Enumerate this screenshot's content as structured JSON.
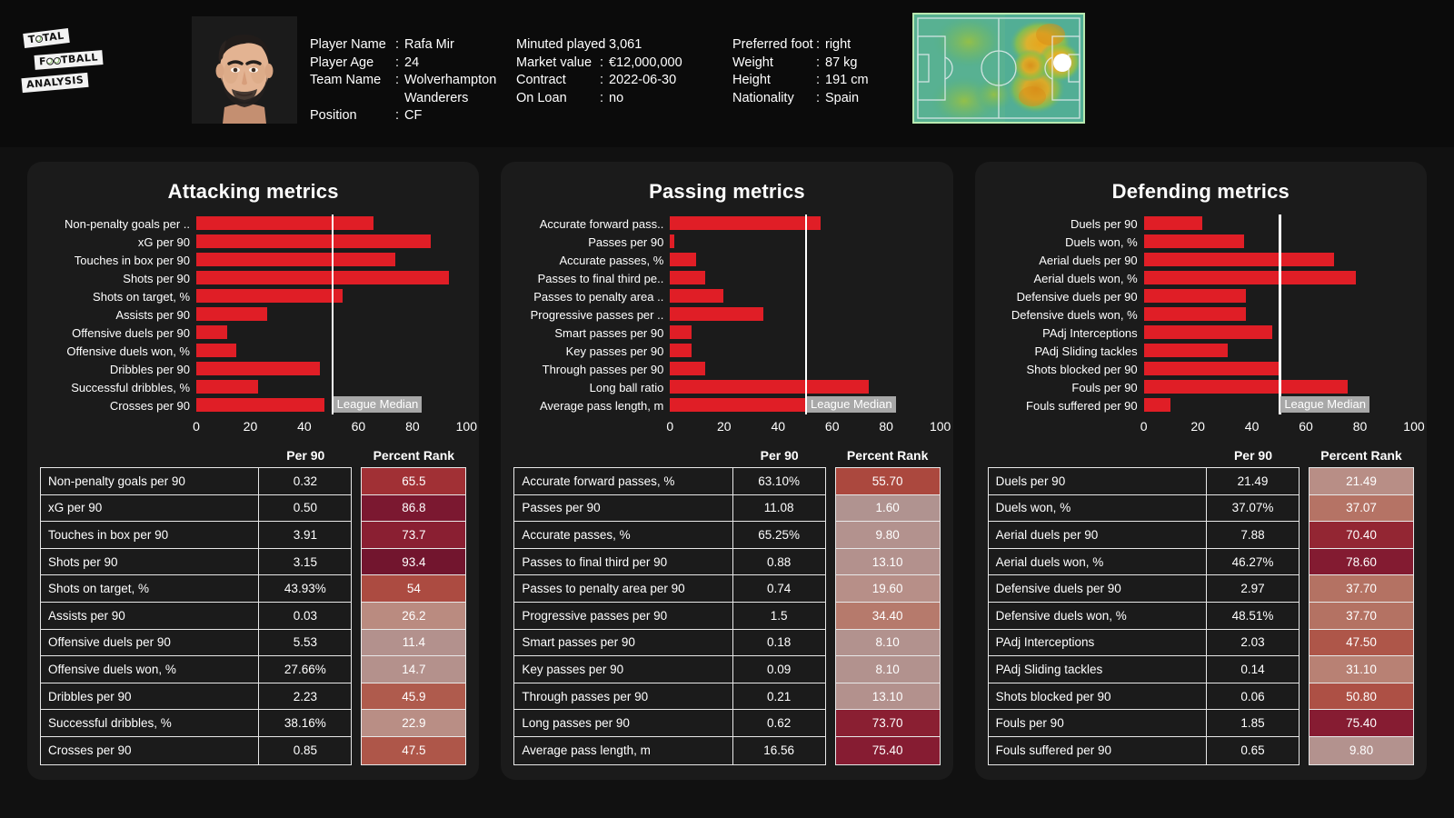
{
  "brand": {
    "line1": "TOTAL",
    "line2": "FOOTBALL",
    "line3": "ANALYSIS"
  },
  "header": {
    "photo_alt": "player-portrait",
    "heatmap_alt": "player-heatmap",
    "columns": [
      {
        "name": "identity",
        "rows": [
          {
            "label": "Player Name",
            "sep": ":",
            "value": "Rafa Mir"
          },
          {
            "label": "Player Age",
            "sep": ":",
            "value": "24"
          },
          {
            "label": "Team Name",
            "sep": ":",
            "value": "Wolverhampton"
          },
          {
            "label": "",
            "sep": "",
            "value": "Wanderers"
          },
          {
            "label": "Position",
            "sep": ":",
            "value": "CF"
          }
        ]
      },
      {
        "name": "contract",
        "rows": [
          {
            "label": "Minuted played",
            "sep": ":",
            "value": "3,061"
          },
          {
            "label": "Market value",
            "sep": ":",
            "value": "€12,000,000"
          },
          {
            "label": "Contract",
            "sep": ":",
            "value": "2022-06-30"
          },
          {
            "label": "On Loan",
            "sep": ":",
            "value": "no"
          }
        ]
      },
      {
        "name": "physical",
        "rows": [
          {
            "label": "Preferred foot",
            "sep": ":",
            "value": "right"
          },
          {
            "label": "Weight",
            "sep": ":",
            "value": "87 kg"
          },
          {
            "label": "Height",
            "sep": ":",
            "value": "191 cm"
          },
          {
            "label": "Nationality",
            "sep": ":",
            "value": "Spain"
          }
        ]
      }
    ]
  },
  "colors": {
    "bar": "#e01e26",
    "median_line": "#ffffff",
    "median_label_bg": "#a8a8a8",
    "panel_bg": "#1b1b1b",
    "page_bg": "#111111",
    "header_bg": "#0b0b0b"
  },
  "median_label": "League Median",
  "table_headers": {
    "metric": "",
    "per90": "Per 90",
    "rank": "Percent Rank"
  },
  "chart_data": [
    {
      "type": "bar",
      "name": "attacking",
      "title": "Attacking metrics",
      "xlabel": "",
      "ylabel": "",
      "xlim": [
        0,
        100
      ],
      "ticks": [
        0,
        20,
        40,
        60,
        80,
        100
      ],
      "median": 50,
      "median_label": "League Median",
      "orientation": "horizontal",
      "grid": false,
      "legend": "none",
      "categories": [
        "Non-penalty goals per ..",
        "xG per 90",
        "Touches in box per 90",
        "Shots per 90",
        "Shots on target, %",
        "Assists per 90",
        "Offensive duels per 90",
        "Offensive duels won, %",
        "Dribbles per 90",
        "Successful dribbles, %",
        "Crosses per 90"
      ],
      "values": [
        65.5,
        86.8,
        73.7,
        93.4,
        54,
        26.2,
        11.4,
        14.7,
        45.9,
        22.9,
        47.5
      ],
      "table": {
        "columns": [
          "",
          "Per 90",
          "Percent Rank"
        ],
        "rows": [
          {
            "metric": "Non-penalty goals per 90",
            "per90": "0.32",
            "rank": "65.5",
            "rank_value": 65.5
          },
          {
            "metric": "xG per 90",
            "per90": "0.50",
            "rank": "86.8",
            "rank_value": 86.8
          },
          {
            "metric": "Touches in box per 90",
            "per90": "3.91",
            "rank": "73.7",
            "rank_value": 73.7
          },
          {
            "metric": "Shots per 90",
            "per90": "3.15",
            "rank": "93.4",
            "rank_value": 93.4
          },
          {
            "metric": "Shots on target, %",
            "per90": "43.93%",
            "rank": "54",
            "rank_value": 54
          },
          {
            "metric": "Assists per 90",
            "per90": "0.03",
            "rank": "26.2",
            "rank_value": 26.2
          },
          {
            "metric": "Offensive duels per 90",
            "per90": "5.53",
            "rank": "11.4",
            "rank_value": 11.4
          },
          {
            "metric": "Offensive duels won, %",
            "per90": "27.66%",
            "rank": "14.7",
            "rank_value": 14.7
          },
          {
            "metric": "Dribbles per 90",
            "per90": "2.23",
            "rank": "45.9",
            "rank_value": 45.9
          },
          {
            "metric": "Successful dribbles, %",
            "per90": "38.16%",
            "rank": "22.9",
            "rank_value": 22.9
          },
          {
            "metric": "Crosses per 90",
            "per90": "0.85",
            "rank": "47.5",
            "rank_value": 47.5
          }
        ]
      }
    },
    {
      "type": "bar",
      "name": "passing",
      "title": "Passing metrics",
      "xlabel": "",
      "ylabel": "",
      "xlim": [
        0,
        100
      ],
      "ticks": [
        0,
        20,
        40,
        60,
        80,
        100
      ],
      "median": 50,
      "median_label": "League Median",
      "orientation": "horizontal",
      "grid": false,
      "legend": "none",
      "categories": [
        "Accurate forward pass..",
        "Passes per 90",
        "Accurate passes, %",
        "Passes to final third pe..",
        "Passes to penalty area ..",
        "Progressive passes per ..",
        "Smart passes per 90",
        "Key passes per 90",
        "Through passes per 90",
        "Long ball ratio",
        "Average pass length, m"
      ],
      "values": [
        55.7,
        1.6,
        9.8,
        13.1,
        19.6,
        34.4,
        8.1,
        8.1,
        13.1,
        73.7,
        75.4
      ],
      "table": {
        "columns": [
          "",
          "Per 90",
          "Percent Rank"
        ],
        "rows": [
          {
            "metric": "Accurate forward passes, %",
            "per90": "63.10%",
            "rank": "55.70",
            "rank_value": 55.7
          },
          {
            "metric": "Passes per 90",
            "per90": "11.08",
            "rank": "1.60",
            "rank_value": 1.6
          },
          {
            "metric": "Accurate passes, %",
            "per90": "65.25%",
            "rank": "9.80",
            "rank_value": 9.8
          },
          {
            "metric": "Passes to final third per 90",
            "per90": "0.88",
            "rank": "13.10",
            "rank_value": 13.1
          },
          {
            "metric": "Passes to penalty area per 90",
            "per90": "0.74",
            "rank": "19.60",
            "rank_value": 19.6
          },
          {
            "metric": "Progressive passes per 90",
            "per90": "1.5",
            "rank": "34.40",
            "rank_value": 34.4
          },
          {
            "metric": "Smart passes per 90",
            "per90": "0.18",
            "rank": "8.10",
            "rank_value": 8.1
          },
          {
            "metric": "Key passes per 90",
            "per90": "0.09",
            "rank": "8.10",
            "rank_value": 8.1
          },
          {
            "metric": "Through passes per 90",
            "per90": "0.21",
            "rank": "13.10",
            "rank_value": 13.1
          },
          {
            "metric": "Long passes per 90",
            "per90": "0.62",
            "rank": "73.70",
            "rank_value": 73.7
          },
          {
            "metric": "Average pass length, m",
            "per90": "16.56",
            "rank": "75.40",
            "rank_value": 75.4
          }
        ]
      }
    },
    {
      "type": "bar",
      "name": "defending",
      "title": "Defending metrics",
      "xlabel": "",
      "ylabel": "",
      "xlim": [
        0,
        100
      ],
      "ticks": [
        0,
        20,
        40,
        60,
        80,
        100
      ],
      "median": 50,
      "median_label": "League Median",
      "orientation": "horizontal",
      "grid": false,
      "legend": "none",
      "categories": [
        "Duels per 90",
        "Duels won, %",
        "Aerial duels per 90",
        "Aerial duels won, %",
        "Defensive duels per 90",
        "Defensive duels won, %",
        "PAdj Interceptions",
        "PAdj Sliding tackles",
        "Shots blocked per 90",
        "Fouls per 90",
        "Fouls suffered per 90"
      ],
      "values": [
        21.49,
        37.07,
        70.4,
        78.6,
        37.7,
        37.7,
        47.5,
        31.1,
        50.8,
        75.4,
        9.8
      ],
      "table": {
        "columns": [
          "",
          "Per 90",
          "Percent Rank"
        ],
        "rows": [
          {
            "metric": "Duels per 90",
            "per90": "21.49",
            "rank": "21.49",
            "rank_value": 21.49
          },
          {
            "metric": "Duels won, %",
            "per90": "37.07%",
            "rank": "37.07",
            "rank_value": 37.07
          },
          {
            "metric": "Aerial duels per 90",
            "per90": "7.88",
            "rank": "70.40",
            "rank_value": 70.4
          },
          {
            "metric": "Aerial duels won, %",
            "per90": "46.27%",
            "rank": "78.60",
            "rank_value": 78.6
          },
          {
            "metric": "Defensive duels per 90",
            "per90": "2.97",
            "rank": "37.70",
            "rank_value": 37.7
          },
          {
            "metric": "Defensive duels won, %",
            "per90": "48.51%",
            "rank": "37.70",
            "rank_value": 37.7
          },
          {
            "metric": "PAdj Interceptions",
            "per90": "2.03",
            "rank": "47.50",
            "rank_value": 47.5
          },
          {
            "metric": "PAdj Sliding tackles",
            "per90": "0.14",
            "rank": "31.10",
            "rank_value": 31.1
          },
          {
            "metric": "Shots blocked per 90",
            "per90": "0.06",
            "rank": "50.80",
            "rank_value": 50.8
          },
          {
            "metric": "Fouls per 90",
            "per90": "1.85",
            "rank": "75.40",
            "rank_value": 75.4
          },
          {
            "metric": "Fouls suffered per 90",
            "per90": "0.65",
            "rank": "9.80",
            "rank_value": 9.8
          }
        ]
      }
    }
  ]
}
